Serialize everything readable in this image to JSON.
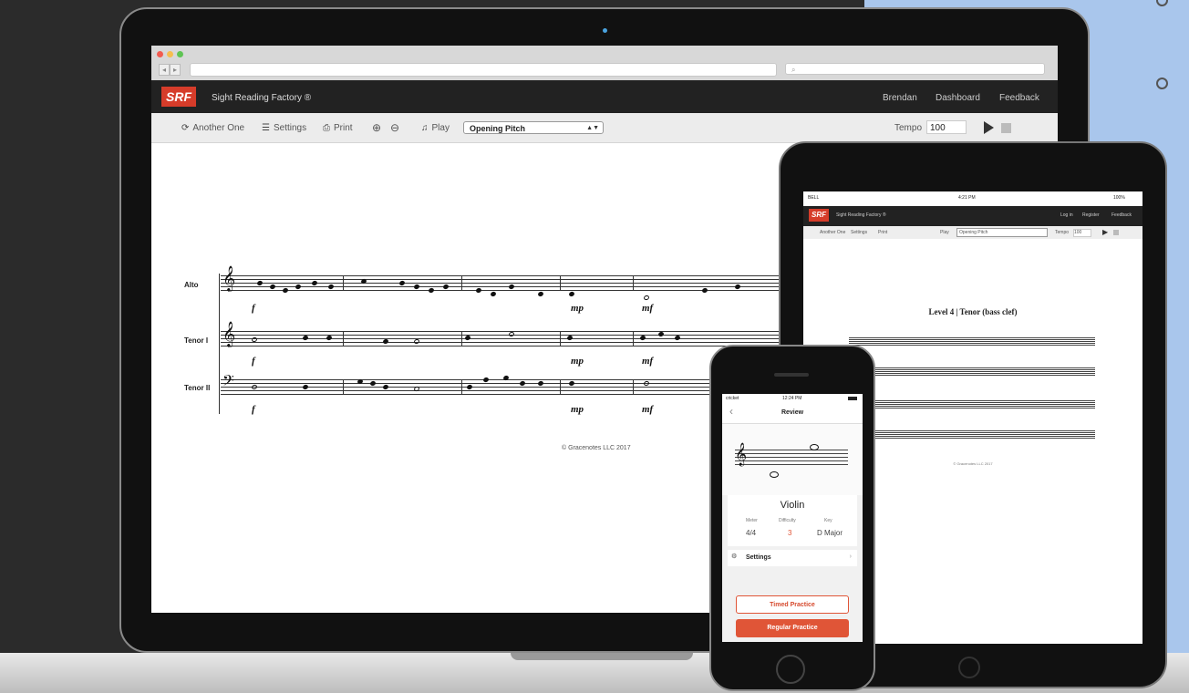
{
  "colors": {
    "brand_red": "#d63c2a",
    "accent_orange": "#e05537",
    "background_blue": "#a9c6ec"
  },
  "laptop": {
    "app": {
      "logo": "SRF",
      "title": "Sight Reading Factory ®",
      "nav": [
        "Brendan",
        "Dashboard",
        "Feedback"
      ]
    },
    "toolbar": {
      "another_one": "Another One",
      "settings": "Settings",
      "print": "Print",
      "play": "Play",
      "play_select": "Opening Pitch",
      "tempo_label": "Tempo",
      "tempo_value": "100"
    },
    "score": {
      "parts": [
        "Alto",
        "Tenor I",
        "Tenor II"
      ],
      "dynamics": [
        "f",
        "mp",
        "mf"
      ],
      "copyright": "© Gracenotes LLC 2017"
    }
  },
  "tablet": {
    "level_title": "Level 4 | Tenor (bass clef)",
    "status": {
      "carrier": "BELL",
      "time": "4:21 PM",
      "battery": "100%"
    },
    "nav": [
      "Log in",
      "Register",
      "Feedback"
    ],
    "toolbar": {
      "another_one": "Another One",
      "settings": "Settings",
      "print": "Print",
      "play": "Play",
      "play_select": "Opening Pitch",
      "tempo_label": "Tempo",
      "tempo_value": "100"
    },
    "copyright": "© Gracenotes LLC 2017"
  },
  "phone": {
    "status": {
      "carrier": "cricket",
      "time": "12:24 PM"
    },
    "header": "Review",
    "instrument": "Violin",
    "meter_label": "Meter",
    "meter": "4/4",
    "difficulty_label": "Difficulty",
    "difficulty": "3",
    "key_label": "Key",
    "key": "D Major",
    "settings": "Settings",
    "timed": "Timed Practice",
    "regular": "Regular Practice"
  }
}
